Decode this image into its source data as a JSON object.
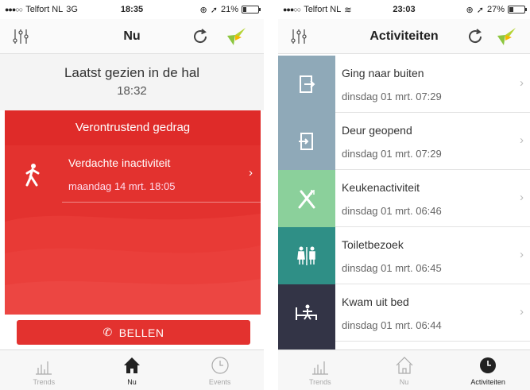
{
  "left": {
    "status": {
      "carrier": "Telfort NL",
      "network": "3G",
      "time": "18:35",
      "battery": "21%",
      "battery_level": 0.21
    },
    "nav_title": "Nu",
    "last_seen": {
      "line1": "Laatst gezien in de hal",
      "line2": "18:32"
    },
    "panel_title": "Verontrustend gedrag",
    "alert": {
      "title": "Verdachte inactiviteit",
      "time": "maandag 14 mrt. 18:05"
    },
    "call_label": "BELLEN",
    "tabs": [
      {
        "label": "Trends",
        "icon": "bar-chart-icon",
        "active": false
      },
      {
        "label": "Nu",
        "icon": "home-icon",
        "active": true
      },
      {
        "label": "Events",
        "icon": "clock-icon",
        "active": false
      }
    ]
  },
  "right": {
    "status": {
      "carrier": "Telfort NL",
      "time": "23:03",
      "battery": "27%",
      "battery_level": 0.27
    },
    "nav_title": "Activiteiten",
    "rows": [
      {
        "title": "Ging naar buiten",
        "time": "dinsdag 01 mrt. 07:29",
        "icon": "exit-door-icon",
        "color": "#8fa9b8"
      },
      {
        "title": "Deur geopend",
        "time": "dinsdag 01 mrt. 07:29",
        "icon": "door-icon",
        "color": "#8fa9b8"
      },
      {
        "title": "Keukenactiviteit",
        "time": "dinsdag 01 mrt. 06:46",
        "icon": "cutlery-icon",
        "color": "#8bd09b"
      },
      {
        "title": "Toiletbezoek",
        "time": "dinsdag 01 mrt. 06:45",
        "icon": "restroom-icon",
        "color": "#2f8f86"
      },
      {
        "title": "Kwam uit bed",
        "time": "dinsdag 01 mrt. 06:44",
        "icon": "bed-icon",
        "color": "#333446"
      }
    ],
    "tabs": [
      {
        "label": "Trends",
        "icon": "bar-chart-icon",
        "active": false
      },
      {
        "label": "Nu",
        "icon": "home-icon",
        "active": false
      },
      {
        "label": "Activiteiten",
        "icon": "clock-icon",
        "active": true
      }
    ]
  },
  "colors": {
    "alert_red": "#e3322f",
    "bird_green": "#8cc63f",
    "bird_yellow": "#f5b800"
  }
}
